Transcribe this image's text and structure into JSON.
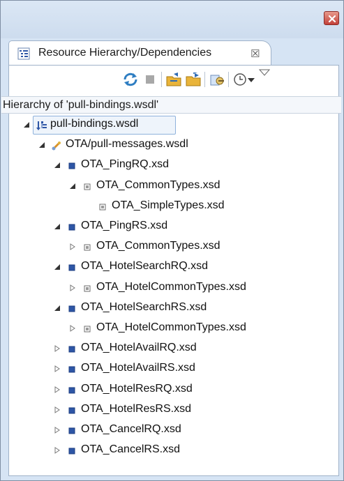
{
  "tab": {
    "icon": "hierarchy-view-icon",
    "title": "Resource Hierarchy/Dependencies",
    "close_symbol": "☒"
  },
  "toolbar": {
    "buttons": [
      "refresh-icon",
      "stop-icon",
      "hierarchy-icon",
      "dependencies-icon",
      "configure-icon",
      "history-icon",
      "view-menu-icon"
    ]
  },
  "hierarchy_label": "Hierarchy of 'pull-bindings.wsdl'",
  "tree": [
    {
      "label": "pull-bindings.wsdl",
      "depth": 0,
      "toggle": "expanded",
      "icon": "root-hierarchy-icon",
      "selected": true
    },
    {
      "label": "OTA/pull-messages.wsdl",
      "depth": 1,
      "toggle": "expanded",
      "icon": "wsdl-icon"
    },
    {
      "label": "OTA_PingRQ.xsd",
      "depth": 2,
      "toggle": "expanded",
      "icon": "xsd-blue-icon"
    },
    {
      "label": "OTA_CommonTypes.xsd",
      "depth": 3,
      "toggle": "expanded",
      "icon": "xsd-grey-icon"
    },
    {
      "label": "OTA_SimpleTypes.xsd",
      "depth": 4,
      "toggle": "none",
      "icon": "xsd-grey-icon"
    },
    {
      "label": "OTA_PingRS.xsd",
      "depth": 2,
      "toggle": "expanded",
      "icon": "xsd-blue-icon"
    },
    {
      "label": "OTA_CommonTypes.xsd",
      "depth": 3,
      "toggle": "collapsed",
      "icon": "xsd-grey-icon"
    },
    {
      "label": "OTA_HotelSearchRQ.xsd",
      "depth": 2,
      "toggle": "expanded",
      "icon": "xsd-blue-icon"
    },
    {
      "label": "OTA_HotelCommonTypes.xsd",
      "depth": 3,
      "toggle": "collapsed",
      "icon": "xsd-grey-icon"
    },
    {
      "label": "OTA_HotelSearchRS.xsd",
      "depth": 2,
      "toggle": "expanded",
      "icon": "xsd-blue-icon"
    },
    {
      "label": "OTA_HotelCommonTypes.xsd",
      "depth": 3,
      "toggle": "collapsed",
      "icon": "xsd-grey-icon"
    },
    {
      "label": "OTA_HotelAvailRQ.xsd",
      "depth": 2,
      "toggle": "collapsed",
      "icon": "xsd-blue-icon"
    },
    {
      "label": "OTA_HotelAvailRS.xsd",
      "depth": 2,
      "toggle": "collapsed",
      "icon": "xsd-blue-icon"
    },
    {
      "label": "OTA_HotelResRQ.xsd",
      "depth": 2,
      "toggle": "collapsed",
      "icon": "xsd-blue-icon"
    },
    {
      "label": "OTA_HotelResRS.xsd",
      "depth": 2,
      "toggle": "collapsed",
      "icon": "xsd-blue-icon"
    },
    {
      "label": "OTA_CancelRQ.xsd",
      "depth": 2,
      "toggle": "collapsed",
      "icon": "xsd-blue-icon"
    },
    {
      "label": "OTA_CancelRS.xsd",
      "depth": 2,
      "toggle": "collapsed",
      "icon": "xsd-blue-icon"
    }
  ],
  "colors": {
    "xsd_blue": "#2e56a6",
    "xsd_grey": "#7a7a7a",
    "selection_border": "#8fb2dc"
  }
}
